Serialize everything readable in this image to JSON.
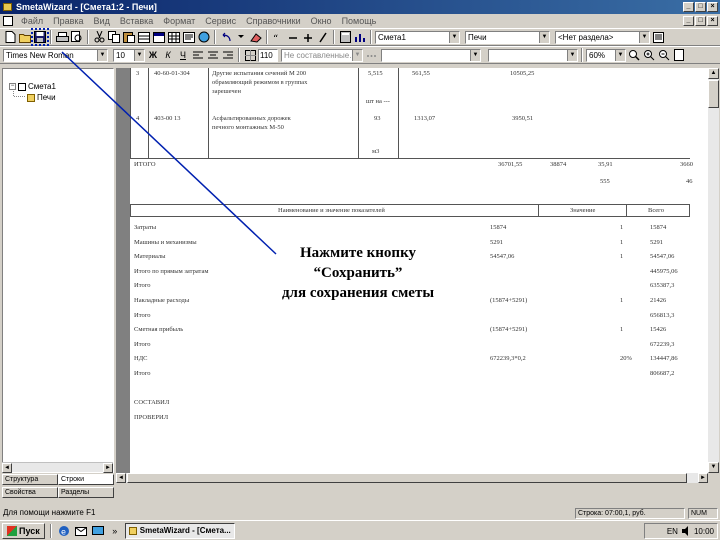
{
  "window": {
    "title": "SmetaWizard - [Смета1:2 - Печи]",
    "btn_min": "_",
    "btn_max": "□",
    "btn_close": "×"
  },
  "menu": {
    "items": [
      "Файл",
      "Правка",
      "Вид",
      "Вставка",
      "Формат",
      "Сервис",
      "Справочники",
      "Окно",
      "Помощь"
    ]
  },
  "toolbar1": {
    "combo_estimate": "Смета1",
    "combo_chapter": "Печи",
    "combo_section": "<Нет раздела>"
  },
  "toolbar2": {
    "font_name": "Times New Roman",
    "font_size": "10",
    "bold": "Ж",
    "italic": "К",
    "underline": "Ч",
    "index_value": "110",
    "style_value": "Не составленные...",
    "zoom_value": "60%"
  },
  "tree": {
    "root_label": "Смета1",
    "child_label": "Печи",
    "expander": "−"
  },
  "left_tabs": {
    "tab1": "Структура",
    "tab2": "Строки",
    "tab3": "Свойства",
    "tab4": "Разделы"
  },
  "doc": {
    "row1_num": "3",
    "row1_code": "40-60-01-304",
    "row1_desc_1": "Другие испытания сечений М 200",
    "row1_desc_2": "обрамляющий режимом в группах",
    "row1_desc_3": "зарешечен",
    "row1_qty": "5,515",
    "row1_price": "561,55",
    "row1_sum": "10505,25",
    "row1_dashes": "шт на ---",
    "row2_num": "4",
    "row2_code": "403-00 13",
    "row2_desc_1": "Асфальтированных дорожек",
    "row2_desc_2": "печного монтажных М-50",
    "row2_qty": "93",
    "row2_price": "1313,07",
    "row2_sum": "3950,51",
    "row2_unit": "м3",
    "total_label": "ИТОГО",
    "total_1": "36701,55",
    "total_2": "38874",
    "total_3": "35,91",
    "total_4": "3660",
    "total_5": "555",
    "total_6": "46",
    "summary_header": "Наименование и значение показателей",
    "summary_col2": "Значение",
    "summary_col3": "Всего",
    "summary_rows": [
      {
        "label": "Затраты",
        "f": "15874",
        "k": "1",
        "v": "15874"
      },
      {
        "label": "Машины и механизмы",
        "f": "5291",
        "k": "1",
        "v": "5291"
      },
      {
        "label": "Материалы",
        "f": "54547,06",
        "k": "1",
        "v": "54547,06"
      },
      {
        "label": "Итого по прямым затратам",
        "f": "",
        "k": "",
        "v": "445975,06"
      },
      {
        "label": "Итого",
        "f": "",
        "k": "",
        "v": "635387,3"
      },
      {
        "label": "Накладные расходы",
        "f": "(15874+5291)",
        "k": "1",
        "v": "21426"
      },
      {
        "label": "Итого",
        "f": "",
        "k": "",
        "v": "656813,3"
      },
      {
        "label": "Сметная прибыль",
        "f": "(15874+5291)",
        "k": "1",
        "v": "15426"
      },
      {
        "label": "Итого",
        "f": "",
        "k": "",
        "v": "672239,3"
      },
      {
        "label": "НДС",
        "f": "672239,3*0,2",
        "k": "20%",
        "v": "134447,86"
      },
      {
        "label": "Итого",
        "f": "",
        "k": "",
        "v": "806687,2"
      }
    ],
    "signature_1": "СОСТАВИЛ",
    "signature_2": "ПРОВЕРИЛ"
  },
  "callout": {
    "line1": "Нажмите кнопку",
    "line2": "“Сохранить”",
    "line3": "для сохранения сметы"
  },
  "status": {
    "hint": "Для помощи нажмите F1",
    "panel1": "Строка: 07:00,1, руб.",
    "panel2": "NUM"
  },
  "taskbar": {
    "start_label": "Пуск",
    "more": "»",
    "task_label": "SmetaWizard - [Смета...",
    "lang": "EN",
    "clock": "10:00"
  },
  "colors": {
    "title_start": "#0a246a",
    "title_end": "#3a6ea5",
    "callout_line": "#0020b0"
  }
}
